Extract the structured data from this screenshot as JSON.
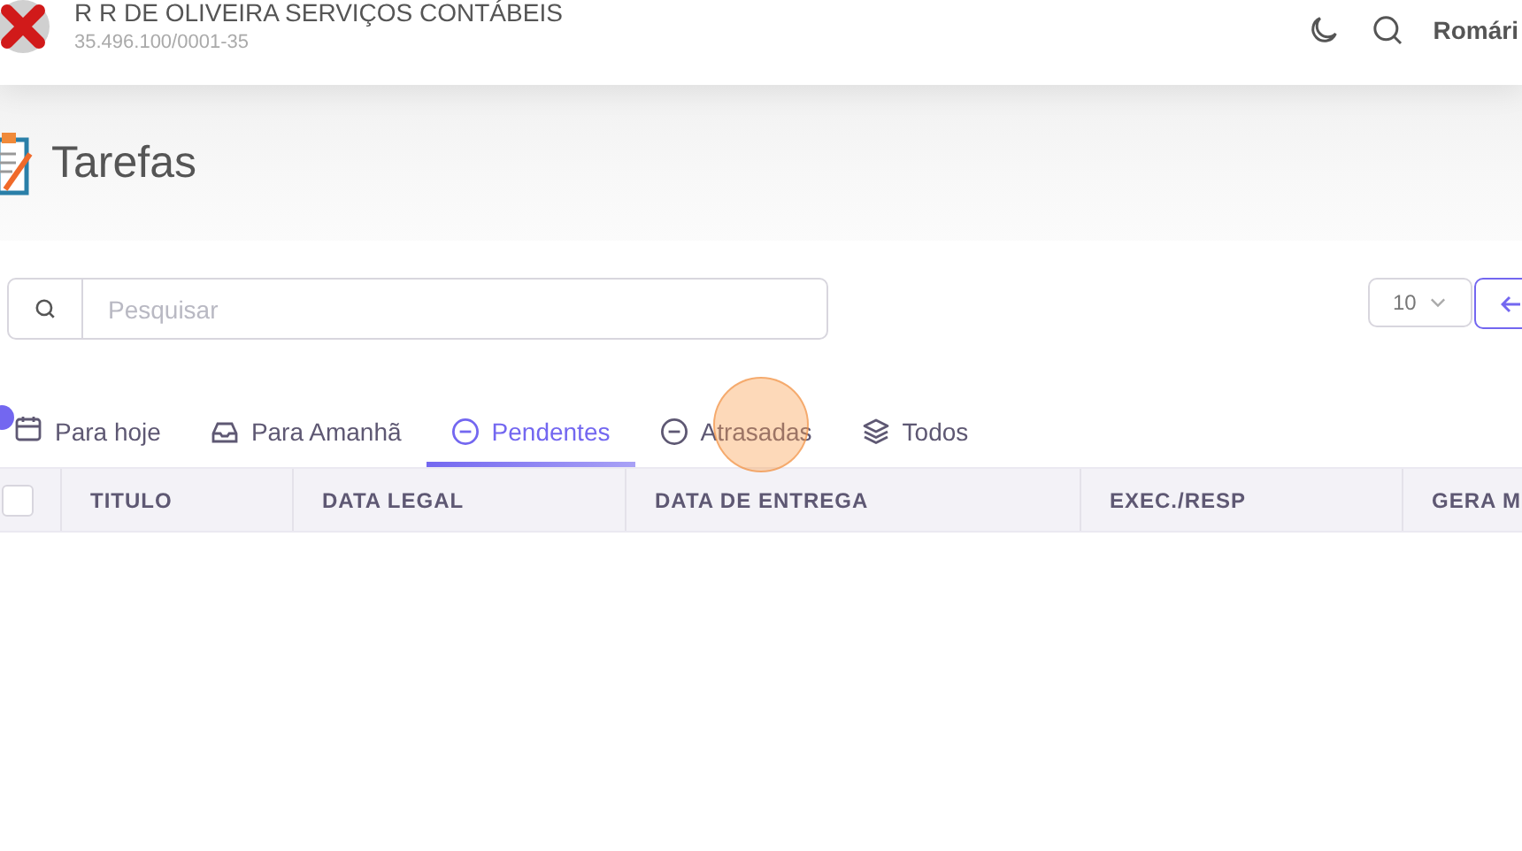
{
  "header": {
    "company": "R R DE OLIVEIRA SERVIÇOS CONTÁBEIS",
    "cnpj": "35.496.100/0001-35",
    "user": "Romári"
  },
  "page": {
    "title": "Tarefas"
  },
  "search": {
    "placeholder": "Pesquisar"
  },
  "page_size": {
    "value": "10"
  },
  "tabs": [
    {
      "label": "Para hoje",
      "selected": false
    },
    {
      "label": "Para Amanhã",
      "selected": false
    },
    {
      "label": "Pendentes",
      "selected": true
    },
    {
      "label": "Atrasadas",
      "selected": false
    },
    {
      "label": "Todos",
      "selected": false
    }
  ],
  "table": {
    "select_all": {
      "checked": false
    },
    "columns": [
      "TITULO",
      "DATA LEGAL",
      "DATA DE ENTREGA",
      "EXEC./RESP",
      "GERA M"
    ]
  }
}
